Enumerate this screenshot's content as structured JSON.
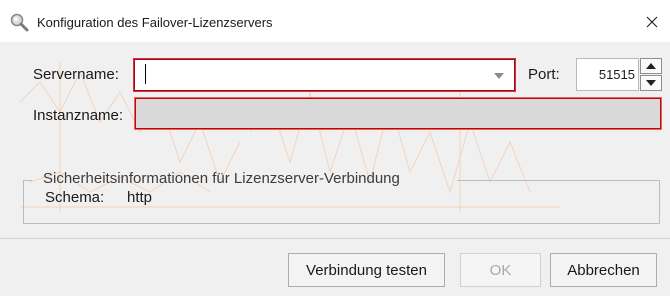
{
  "window": {
    "title": "Konfiguration des Failover-Lizenzservers",
    "close_glyph": "✕",
    "icon": "magnifier-icon"
  },
  "form": {
    "servername_label": "Servername:",
    "servername_value": "",
    "port_label": "Port:",
    "port_value": "51515",
    "instanzname_label": "Instanzname:",
    "instanzname_value": ""
  },
  "security_group": {
    "title": "Sicherheitsinformationen für Lizenzserver-Verbindung",
    "schema_label": "Schema:",
    "schema_value": "http"
  },
  "buttons": {
    "test_label": "Verbindung testen",
    "ok_label": "OK",
    "cancel_label": "Abbrechen",
    "ok_enabled": false
  },
  "colors": {
    "error_border": "#c80000",
    "watermark": "#f0a060"
  }
}
